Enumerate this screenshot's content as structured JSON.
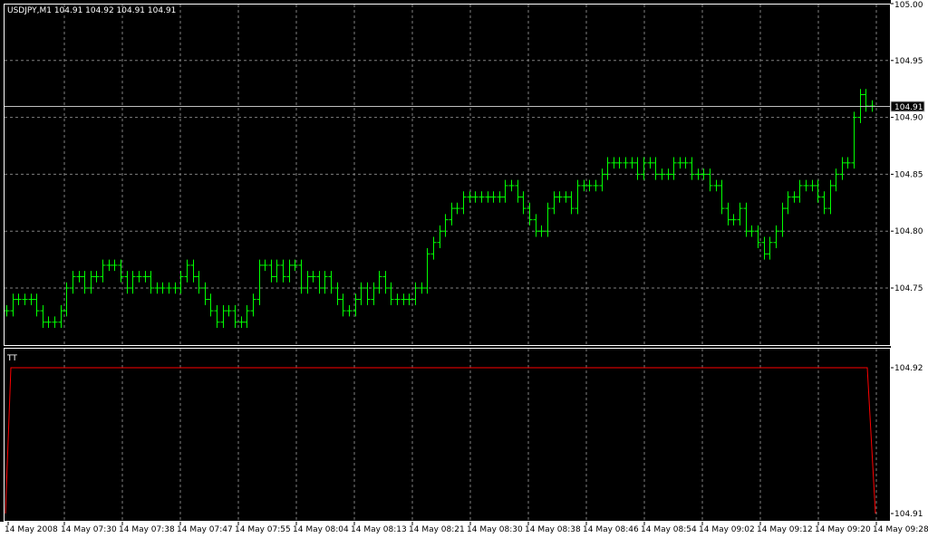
{
  "window": {
    "symbol_info": "USDJPY,M1  104.91 104.92 104.91 104.91",
    "indicator_label": "TT"
  },
  "colors": {
    "background": "#000000",
    "frame": "#ffffff",
    "grid": "#7f7f7f",
    "bars": "#00ff00",
    "indicator": "#ff0000",
    "price_line": "#c0c0c0"
  },
  "chart_data": [
    {
      "type": "ohlc",
      "title": "USDJPY,M1",
      "ylim": [
        104.7,
        105.0
      ],
      "yticks": [
        "105.00",
        "104.95",
        "104.90",
        "104.85",
        "104.80",
        "104.75"
      ],
      "current_price": "104.91",
      "xticks": [
        "14 May 2008",
        "14 May 07:30",
        "14 May 07:38",
        "14 May 07:47",
        "14 May 07:55",
        "14 May 08:04",
        "14 May 08:13",
        "14 May 08:21",
        "14 May 08:30",
        "14 May 08:38",
        "14 May 08:46",
        "14 May 08:54",
        "14 May 09:02",
        "14 May 09:12",
        "14 May 09:20",
        "14 May 09:28"
      ],
      "closes": [
        104.73,
        104.74,
        104.74,
        104.74,
        104.74,
        104.73,
        104.72,
        104.72,
        104.72,
        104.73,
        104.75,
        104.76,
        104.76,
        104.75,
        104.76,
        104.76,
        104.77,
        104.77,
        104.77,
        104.76,
        104.75,
        104.76,
        104.76,
        104.76,
        104.75,
        104.75,
        104.75,
        104.75,
        104.75,
        104.76,
        104.77,
        104.76,
        104.75,
        104.74,
        104.73,
        104.72,
        104.73,
        104.73,
        104.72,
        104.72,
        104.73,
        104.74,
        104.77,
        104.77,
        104.76,
        104.77,
        104.76,
        104.77,
        104.77,
        104.75,
        104.76,
        104.76,
        104.75,
        104.76,
        104.75,
        104.74,
        104.73,
        104.73,
        104.74,
        104.75,
        104.74,
        104.75,
        104.76,
        104.75,
        104.74,
        104.74,
        104.74,
        104.74,
        104.75,
        104.75,
        104.78,
        104.79,
        104.8,
        104.81,
        104.82,
        104.82,
        104.83,
        104.83,
        104.83,
        104.83,
        104.83,
        104.83,
        104.83,
        104.84,
        104.84,
        104.83,
        104.82,
        104.81,
        104.8,
        104.8,
        104.82,
        104.83,
        104.83,
        104.83,
        104.82,
        104.84,
        104.84,
        104.84,
        104.84,
        104.85,
        104.86,
        104.86,
        104.86,
        104.86,
        104.86,
        104.85,
        104.86,
        104.86,
        104.85,
        104.85,
        104.85,
        104.86,
        104.86,
        104.86,
        104.85,
        104.85,
        104.85,
        104.84,
        104.84,
        104.82,
        104.81,
        104.81,
        104.82,
        104.8,
        104.8,
        104.79,
        104.78,
        104.79,
        104.8,
        104.82,
        104.83,
        104.83,
        104.84,
        104.84,
        104.84,
        104.83,
        104.82,
        104.84,
        104.85,
        104.86,
        104.86,
        104.9,
        104.92,
        104.91,
        104.91
      ]
    },
    {
      "type": "line",
      "title": "TT",
      "yticks": [
        "104.92",
        "104.91"
      ],
      "ylim": [
        104.91,
        104.92
      ],
      "values": [
        104.91,
        104.92,
        104.92,
        104.92,
        104.91
      ]
    }
  ]
}
